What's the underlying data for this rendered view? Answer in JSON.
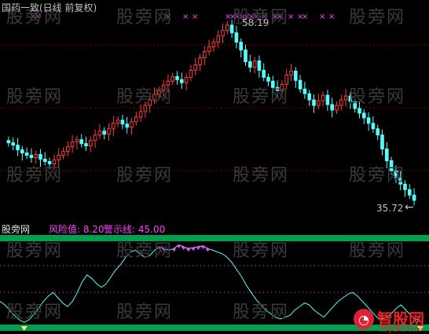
{
  "top_panel": {
    "title": "国药一致(日线 前复权)",
    "high_label": "58.19",
    "low_label": "35.72",
    "arrow_glyph": "←",
    "colors": {
      "up": "#ff3b3b",
      "down": "#54ffff",
      "marker": "#ff40ff",
      "grid": "#8b0000",
      "text": "#c0c0c0"
    },
    "markers": "×"
  },
  "bottom_panel": {
    "indicator_name": "股旁网",
    "risk_label": "风险值: 8.20",
    "warning_label": "警示线: 45.00",
    "colors": {
      "line": "#54ffff",
      "band": "#00a050",
      "risk_text": "#ff40ff",
      "warning_text": "#ff40ff"
    }
  },
  "watermark": "股旁网",
  "logo": {
    "text": "智股网",
    "url": "caiyuku.com"
  },
  "chart_data": {
    "type": "candlestick",
    "title": "国药一致(日线 前复权)",
    "annotations": [
      "58.19",
      "35.72"
    ],
    "ohlc_closes": [
      43.1,
      42.8,
      42.2,
      41.8,
      41.5,
      41.2,
      41.6,
      41.0,
      40.7,
      40.4,
      40.9,
      41.5,
      42.0,
      42.6,
      43.2,
      43.5,
      43.0,
      42.7,
      43.4,
      44.1,
      44.6,
      44.2,
      44.9,
      45.6,
      46.0,
      45.5,
      45.1,
      45.8,
      46.4,
      47.1,
      47.9,
      48.6,
      49.3,
      49.8,
      50.5,
      51.0,
      51.6,
      51.2,
      50.8,
      51.5,
      52.4,
      53.1,
      54.0,
      54.8,
      55.4,
      56.0,
      56.8,
      57.5,
      58.19,
      57.2,
      56.0,
      55.0,
      53.5,
      52.8,
      53.6,
      52.4,
      51.5,
      51.0,
      50.2,
      49.8,
      50.6,
      51.8,
      52.3,
      51.1,
      50.0,
      49.4,
      48.6,
      47.9,
      48.5,
      49.2,
      48.0,
      47.3,
      47.9,
      48.6,
      49.1,
      48.4,
      47.5,
      46.9,
      46.3,
      45.6,
      44.9,
      44.1,
      42.3,
      40.8,
      39.5,
      38.6,
      37.8,
      37.1,
      36.4,
      35.72
    ],
    "indicator": {
      "name": "风险值",
      "value": 8.2,
      "warning_line": 45.0,
      "series": [
        30,
        26,
        20,
        14,
        9,
        6,
        9,
        15,
        22,
        30,
        36,
        40,
        34,
        28,
        24,
        30,
        40,
        52,
        60,
        56,
        50,
        46,
        50,
        58,
        66,
        72,
        80,
        86,
        88,
        84,
        80,
        82,
        88,
        92,
        90,
        88,
        90,
        94,
        92,
        90,
        91,
        92,
        93,
        90,
        88,
        86,
        84,
        80,
        74,
        66,
        58,
        48,
        40,
        32,
        26,
        20,
        16,
        12,
        10,
        12,
        14,
        20,
        24,
        28,
        26,
        20,
        16,
        12,
        18,
        24,
        30,
        34,
        38,
        40,
        36,
        30,
        24,
        18,
        12,
        10,
        12,
        16,
        22,
        26,
        20,
        14,
        10,
        8.2
      ]
    }
  }
}
